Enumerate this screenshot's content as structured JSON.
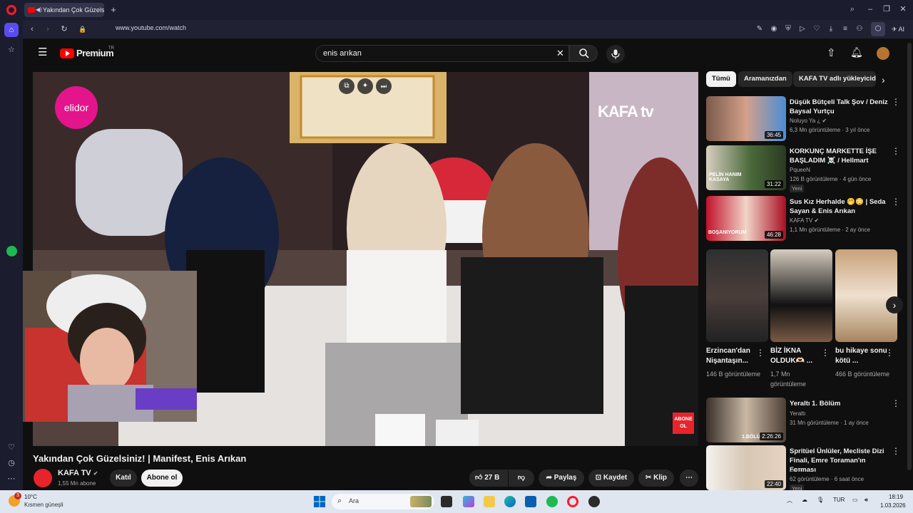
{
  "browser": {
    "tab_title": "Yakından Çok Güzelsi",
    "url": "www.youtube.com/watch",
    "ai_label": "AI"
  },
  "yt": {
    "premium_label": "Premium",
    "tr_label": "TR",
    "search_value": "enis arıkan",
    "video_title": "Yakından Çok Güzelsiniz! | Manifest, Enis Arıkan",
    "channel_name": "KAFA TV",
    "subscribers": "1,55 Mn abone",
    "join_label": "Katıl",
    "subscribe_label": "Abone ol",
    "likes": "27 B",
    "share_label": "Paylaş",
    "save_label": "Kaydet",
    "clip_label": "Klip",
    "overlay_brand": "elidor",
    "overlay_logo": "KAFA tv",
    "overlay_corner": "ABONE OL"
  },
  "chips": [
    "Tümü",
    "Aramanızdan",
    "KAFA TV adlı yükleyiciden"
  ],
  "recs": [
    {
      "title": "Düşük Bütçeli Talk Şov / Deniz Baysal Yurtçu",
      "channel": "Noluyo Ya ¿",
      "meta": "6,3 Mn görüntüleme · 3 yıl önce",
      "duration": "36:45"
    },
    {
      "title": "KORKUNÇ MARKETTE İŞE BAŞLADIM ☠️ / Hellmart",
      "channel": "PqueeN",
      "meta": "126 B görüntüleme · 4 gün önce",
      "duration": "31:22",
      "badge": "Yeni",
      "thumb_text": "PELİN HANIM KASAYA"
    },
    {
      "title": "Sus Kız Herhalde 🤭😳 | Seda Sayan & Enis Arıkan",
      "channel": "KAFA TV",
      "meta": "1,1 Mn görüntüleme · 2 ay önce",
      "duration": "46:28",
      "thumb_text": "BOŞANIYORUM"
    },
    {
      "title": "Yeraltı 1. Bölüm",
      "channel": "Yeraltı",
      "meta": "31 Mn görüntüleme · 1 ay önce",
      "duration": "2:26:26",
      "thumb_text": "1.BÖLÜM"
    },
    {
      "title": "Spritüel Ünlüler, Mecliste Dizi Finali, Emre Toraman'ın Forması",
      "channel": "Zann",
      "meta": "62 görüntüleme · 6 saat önce",
      "duration": "22:40",
      "badge": "Yeni"
    }
  ],
  "shorts": [
    {
      "title": "Erzincan'dan Nişantaşın...",
      "views": "146 B görüntüleme"
    },
    {
      "title": "BİZ İKNA OLDUK🫶🏻 ...",
      "views": "1,7 Mn görüntüleme"
    },
    {
      "title": "bu hikaye sonu kötü ...",
      "views": "466 B görüntüleme"
    }
  ],
  "taskbar": {
    "temp": "10°C",
    "weather": "Kısmen güneşli",
    "weather_badge": "3",
    "search_placeholder": "Ara",
    "lang": "TUR",
    "time": "18:19",
    "date": "1.03.2026"
  }
}
